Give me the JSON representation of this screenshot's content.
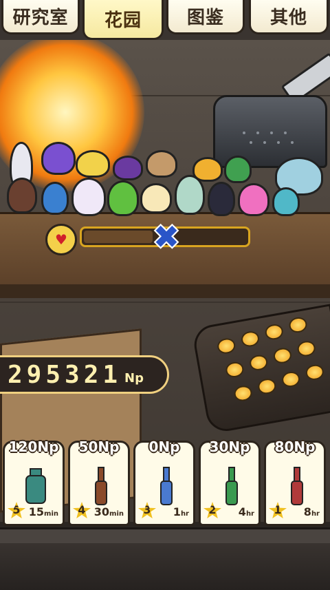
{
  "tabs": [
    {
      "label": "研究室",
      "active": false
    },
    {
      "label": "花园",
      "active": true
    },
    {
      "label": "图鉴",
      "active": false
    },
    {
      "label": "其他",
      "active": false
    }
  ],
  "gauge": {
    "icon": "heart-icon",
    "status_icon": "cross-icon",
    "symbol": "✖"
  },
  "score": {
    "value": "295321",
    "unit": "Np"
  },
  "cards": [
    {
      "price": "120Np",
      "level": "5",
      "time_value": "15",
      "time_unit": "min",
      "bottle_color": "#3a8a80"
    },
    {
      "price": "50Np",
      "level": "4",
      "time_value": "30",
      "time_unit": "min",
      "bottle_color": "#8a4a2a"
    },
    {
      "price": "0Np",
      "level": "3",
      "time_value": "1",
      "time_unit": "hr",
      "bottle_color": "#4a7ad0"
    },
    {
      "price": "30Np",
      "level": "2",
      "time_value": "4",
      "time_unit": "hr",
      "bottle_color": "#3a9a50"
    },
    {
      "price": "80Np",
      "level": "1",
      "time_value": "8",
      "time_unit": "hr",
      "bottle_color": "#b03a3a"
    }
  ]
}
